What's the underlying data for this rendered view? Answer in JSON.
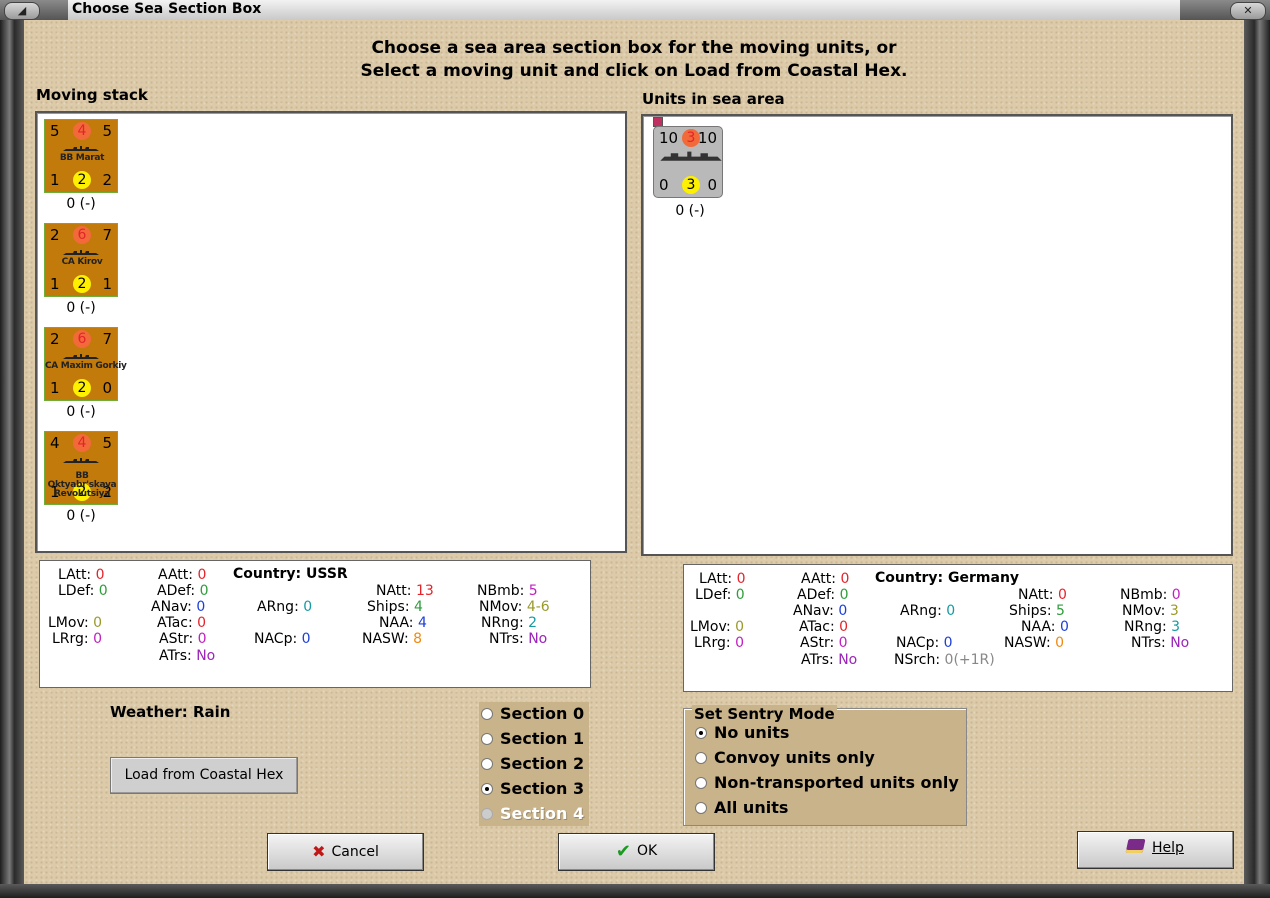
{
  "window": {
    "title": "Choose Sea Section Box"
  },
  "instructions": {
    "line1": "Choose a sea area section box for the moving units, or",
    "line2": "Select a moving unit and click on Load from Coastal Hex."
  },
  "moving_stack": {
    "label": "Moving stack",
    "units": [
      {
        "name": "BB Marat",
        "tl": "5",
        "tc": "4",
        "tr": "5",
        "bl": "1",
        "bc": "2",
        "br": "2",
        "value": "0 (-)"
      },
      {
        "name": "CA Kirov",
        "tl": "2",
        "tc": "6",
        "tr": "7",
        "bl": "1",
        "bc": "2",
        "br": "1",
        "value": "0 (-)"
      },
      {
        "name": "CA Maxim Gorkiy",
        "tl": "2",
        "tc": "6",
        "tr": "7",
        "bl": "1",
        "bc": "2",
        "br": "0",
        "value": "0 (-)"
      },
      {
        "name": "BB Oktyabr'skaya Revolutsiya",
        "tl": "4",
        "tc": "4",
        "tr": "5",
        "bl": "1",
        "bc": "2",
        "br": "2",
        "value": "0 (-)"
      }
    ]
  },
  "sea_area": {
    "label": "Units in sea area",
    "units": [
      {
        "name": "",
        "tl": "10",
        "tc": "3",
        "tr": "10",
        "bl": "0",
        "bc": "3",
        "br": "0",
        "value": "0 (-)"
      }
    ]
  },
  "stats_left": {
    "country_label": "Country: USSR",
    "LAtt": "0",
    "LDef": "0",
    "LMov": "0",
    "LRrg": "0",
    "AAtt": "0",
    "ADef": "0",
    "ANav": "0",
    "ATac": "0",
    "AStr": "0",
    "ATrs": "No",
    "ARng": "0",
    "NACp": "0",
    "NAtt": "13",
    "Ships": "4",
    "NAA": "4",
    "NASW": "8",
    "NBmb": "5",
    "NMov": "4-6",
    "NRng": "2",
    "NTrs": "No"
  },
  "stats_right": {
    "country_label": "Country: Germany",
    "LAtt": "0",
    "LDef": "0",
    "LMov": "0",
    "LRrg": "0",
    "AAtt": "0",
    "ADef": "0",
    "ANav": "0",
    "ATac": "0",
    "AStr": "0",
    "ATrs": "No",
    "ARng": "0",
    "NACp": "0",
    "NSrch": "0(+1R)",
    "NAtt": "0",
    "Ships": "5",
    "NAA": "0",
    "NASW": "0",
    "NBmb": "0",
    "NMov": "3",
    "NRng": "3",
    "NTrs": "No"
  },
  "weather": {
    "label": "Weather:",
    "value": "Rain"
  },
  "load_button": "Load from Coastal Hex",
  "sections": [
    {
      "label": "Section 0",
      "selected": false,
      "enabled": true
    },
    {
      "label": "Section 1",
      "selected": false,
      "enabled": true
    },
    {
      "label": "Section 2",
      "selected": false,
      "enabled": true
    },
    {
      "label": "Section 3",
      "selected": true,
      "enabled": true
    },
    {
      "label": "Section 4",
      "selected": false,
      "enabled": false
    }
  ],
  "sentry": {
    "title": "Set Sentry Mode",
    "options": [
      {
        "label": "No units",
        "selected": true
      },
      {
        "label": "Convoy units only",
        "selected": false
      },
      {
        "label": "Non-transported units only",
        "selected": false
      },
      {
        "label": "All units",
        "selected": false
      }
    ]
  },
  "buttons": {
    "cancel": "Cancel",
    "ok": "OK",
    "help": "Help"
  },
  "colors": {
    "counter_ussr": "#c27a0a",
    "counter_germany": "#b9b9b9",
    "panel_bg": "#dccaa8"
  }
}
